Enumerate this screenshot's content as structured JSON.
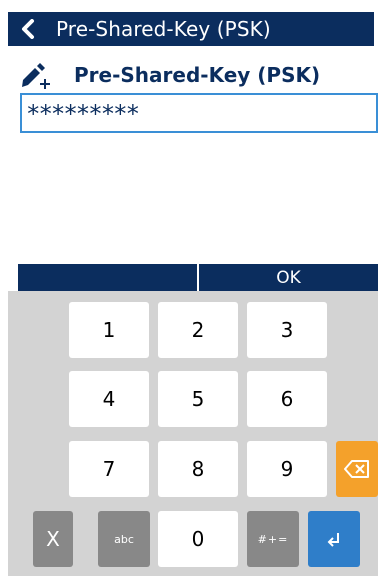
{
  "header": {
    "title": "Pre-Shared-Key (PSK)",
    "back_icon": "chevron-left-icon"
  },
  "field": {
    "label": "Pre-Shared-Key (PSK)",
    "icon": "edit-add-icon",
    "value": "*********"
  },
  "action_bar": {
    "left_label": "",
    "ok_label": "OK"
  },
  "keypad": {
    "keys": {
      "k1": "1",
      "k2": "2",
      "k3": "3",
      "k4": "4",
      "k5": "5",
      "k6": "6",
      "k7": "7",
      "k8": "8",
      "k9": "9",
      "k0": "0"
    },
    "cancel_label": "X",
    "abc_label": "abc",
    "symbols_label": "#+=",
    "backspace_icon": "backspace-icon",
    "enter_icon": "enter-icon"
  },
  "colors": {
    "navy": "#0b2d5e",
    "input_border": "#3a8fd6",
    "keyboard_bg": "#d3d3d3",
    "backspace": "#f4a12b",
    "enter": "#2f7ec9",
    "gray_key": "#888888"
  }
}
